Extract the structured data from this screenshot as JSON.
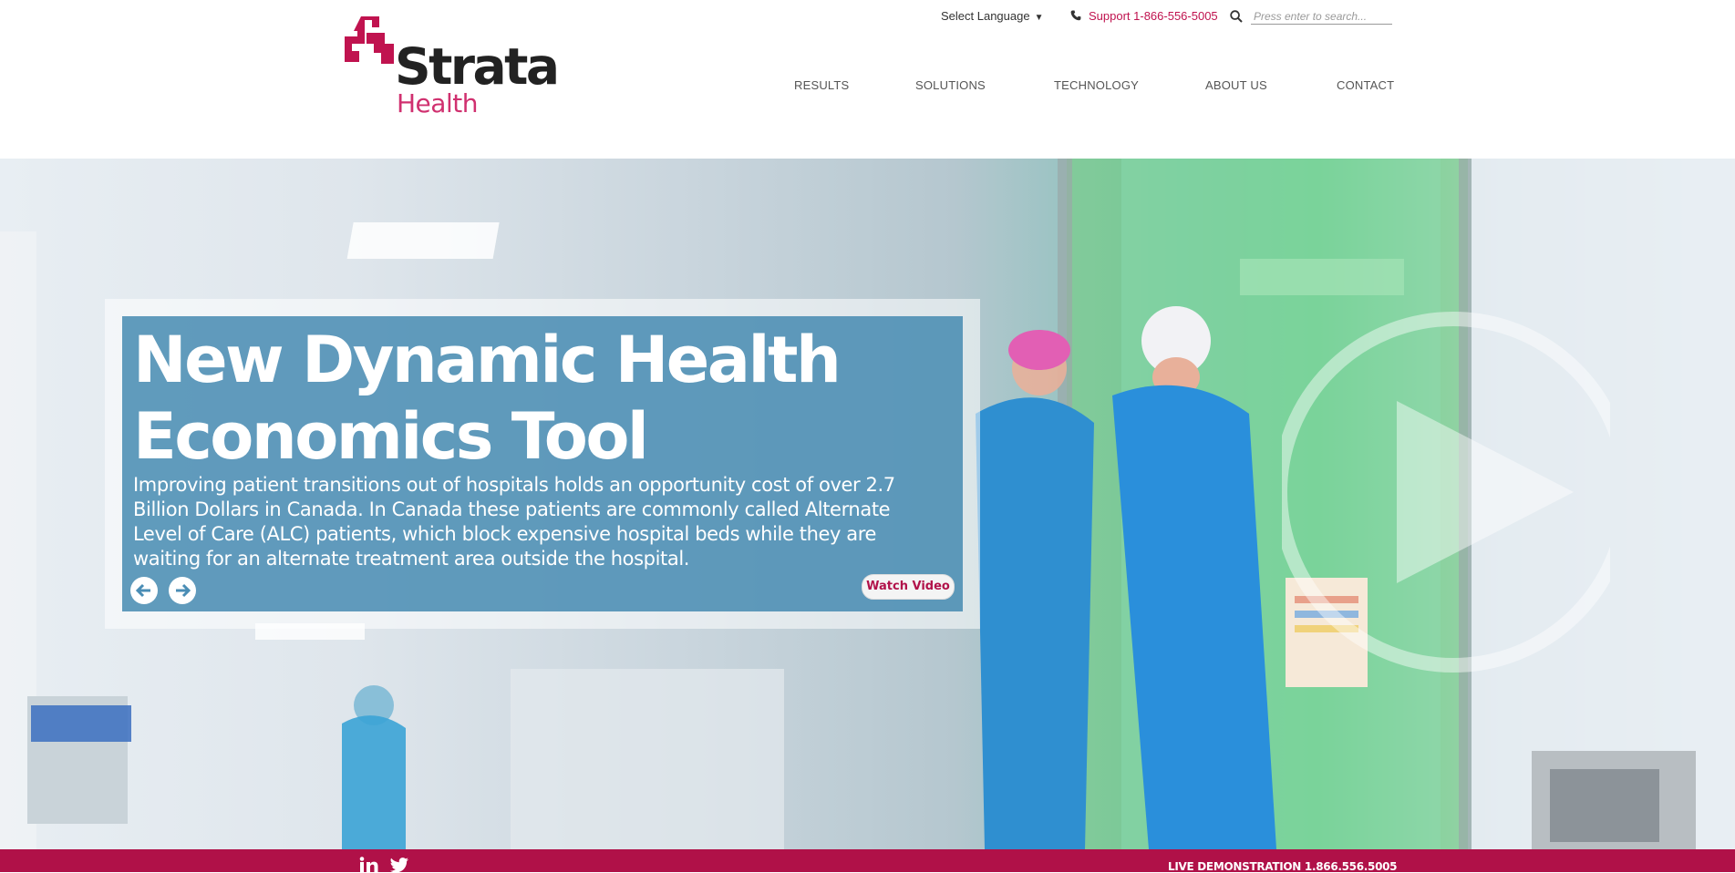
{
  "colors": {
    "brand": "#c0134f",
    "footer": "#b01148",
    "promo_bg": "#4086af"
  },
  "logo": {
    "word": "Strata",
    "sub": "Health"
  },
  "topbar": {
    "language_label": "Select Language",
    "support_text": "Support 1-866-556-5005",
    "search_placeholder": "Press enter to search..."
  },
  "nav": {
    "items": [
      {
        "label": "RESULTS"
      },
      {
        "label": "SOLUTIONS"
      },
      {
        "label": "TECHNOLOGY"
      },
      {
        "label": "ABOUT US"
      },
      {
        "label": "CONTACT"
      }
    ]
  },
  "hero": {
    "title_line1": "New Dynamic Health",
    "title_line2": "Economics Tool",
    "body": "Improving patient transitions out of hospitals holds an opportunity cost of over 2.7 Billion Dollars in Canada. In Canada these patients are commonly called Alternate Level of Care (ALC) patients, which block expensive hospital beds while they are waiting for an alternate treatment area outside the hospital.",
    "watch_label": "Watch Video",
    "prev_icon": "arrow-left-icon",
    "next_icon": "arrow-right-icon",
    "play_icon": "play-circle-icon"
  },
  "footer": {
    "demo_text": "LIVE DEMONSTRATION 1.866.556.5005",
    "social_icons": [
      "linkedin-icon",
      "twitter-icon"
    ]
  }
}
